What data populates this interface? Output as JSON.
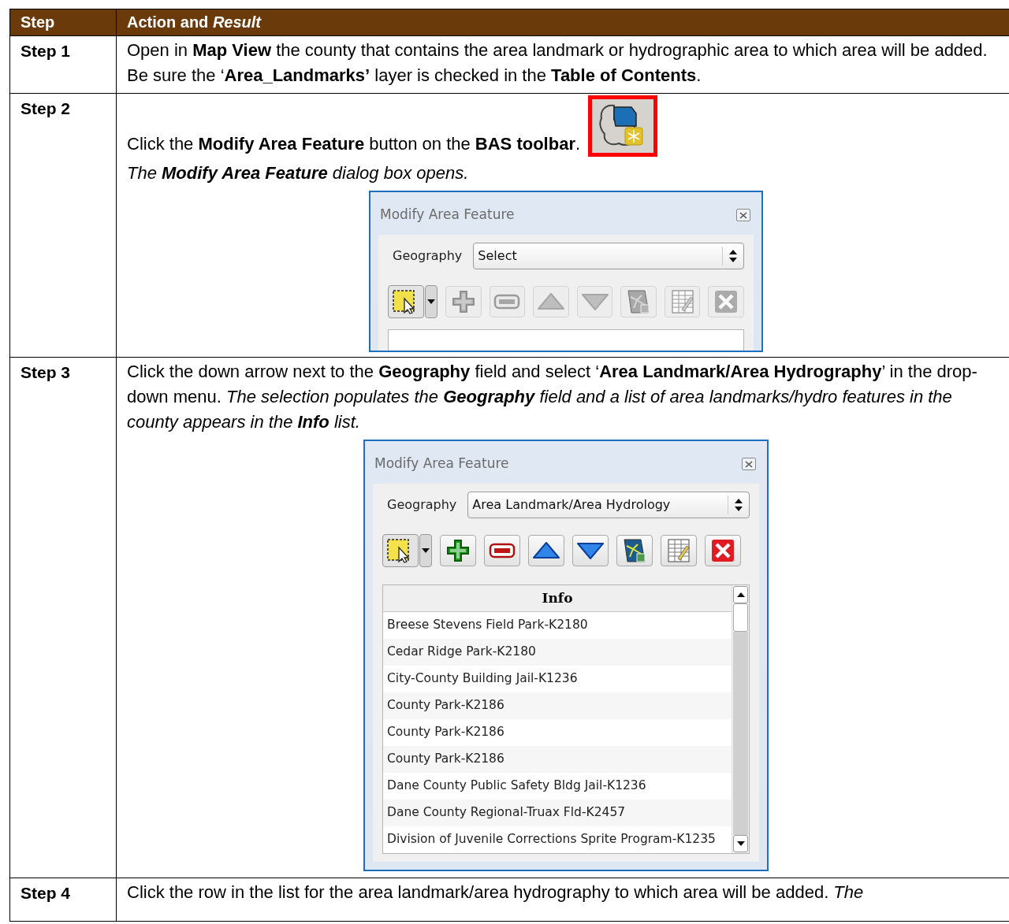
{
  "table": {
    "columns": [
      "Step",
      "Action and *Result*"
    ],
    "rows": [
      {
        "step": "Step 1",
        "blocks": [
          {
            "kind": "text",
            "runs": [
              {
                "text": "Open in **Map View** the county that contains the area landmark or hydrographic area to which area will be added. Be sure the ‘**Area_Landmarks’** layer is checked in the **Table of Contents**.",
                "italic": false
              }
            ]
          }
        ]
      },
      {
        "step": "Step 2",
        "blocks": [
          {
            "kind": "text",
            "button_icon": true,
            "runs": [
              {
                "text": "Click the **Modify Area Feature** button on the **BAS toolbar**.",
                "italic": false
              }
            ]
          },
          {
            "kind": "text",
            "runs": [
              {
                "text": "The **Modify Area Feature** dialog box opens.",
                "italic": true
              }
            ]
          },
          {
            "kind": "dialog",
            "title": "Modify Area Feature",
            "geography_label": "Geography",
            "geography_value": "Select",
            "tools_enabled": false
          }
        ]
      },
      {
        "step": "Step 3",
        "blocks": [
          {
            "kind": "text",
            "runs": [
              {
                "text": "Click the down arrow next to the **Geography** field and select ‘**Area Landmark/Area Hydrography**’ in the drop-down menu. ",
                "italic": false
              },
              {
                "text": "The selection populates the **Geography** field and a list of area landmarks/hydro features in the county appears in the **Info** list.",
                "italic": true
              }
            ]
          },
          {
            "kind": "dialog",
            "title": "Modify Area Feature",
            "geography_label": "Geography",
            "geography_value": "Area Landmark/Area Hydrology",
            "tools_enabled": true,
            "list": {
              "header": "Info",
              "items": [
                "Breese Stevens Field Park-K2180",
                "Cedar Ridge Park-K2180",
                "City-County Building Jail-K1236",
                "County Park-K2186",
                "County Park-K2186",
                "County Park-K2186",
                "Dane County Public Safety Bldg Jail-K1236",
                "Dane County Regional-Truax Fld-K2457",
                "Division of Juvenile Corrections Sprite Program-K1235"
              ]
            }
          }
        ]
      },
      {
        "step": "Step 4",
        "blocks": [
          {
            "kind": "text",
            "runs": [
              {
                "text": "Click the row in the list for the area landmark/area hydrography to which area will be added. ",
                "italic": false
              },
              {
                "text": "The",
                "italic": true
              }
            ]
          }
        ]
      }
    ]
  }
}
